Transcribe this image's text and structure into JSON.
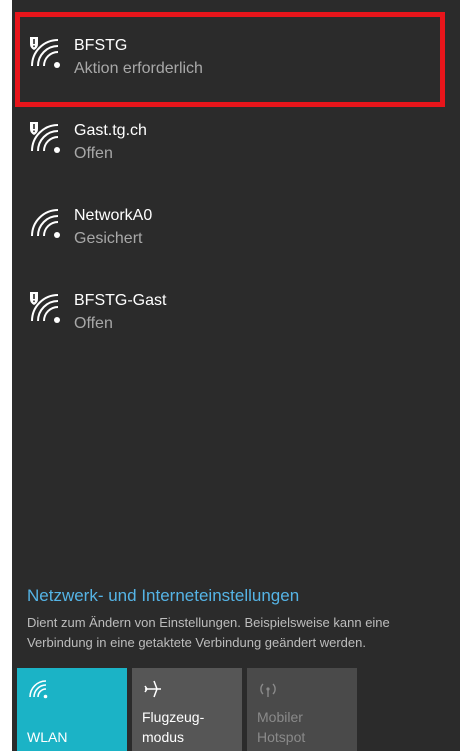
{
  "networks": [
    {
      "ssid": "BFSTG",
      "status": "Aktion erforderlich",
      "icon": "wifi-shield-warning-icon"
    },
    {
      "ssid": "Gast.tg.ch",
      "status": "Offen",
      "icon": "wifi-shield-warning-icon"
    },
    {
      "ssid": "NetworkA0",
      "status": "Gesichert",
      "icon": "wifi-icon"
    },
    {
      "ssid": "BFSTG-Gast",
      "status": "Offen",
      "icon": "wifi-shield-warning-icon"
    }
  ],
  "settings": {
    "link": "Netzwerk- und Interneteinstellungen",
    "description": "Dient zum Ändern von Einstellungen. Beispielsweise kann eine Verbindung in eine getaktete Verbindung geändert werden."
  },
  "quick_actions": [
    {
      "label_line1": "WLAN",
      "label_line2": "",
      "icon": "wifi-icon",
      "active": true
    },
    {
      "label_line1": "Flugzeug-",
      "label_line2": "modus",
      "icon": "airplane-icon",
      "active": false
    },
    {
      "label_line1": "Mobiler",
      "label_line2": "Hotspot",
      "icon": "hotspot-icon",
      "active": false,
      "disabled": true
    }
  ],
  "colors": {
    "panel_bg": "#2b2b2b",
    "accent": "#1bb3c6",
    "link": "#55b4e6",
    "highlight_box": "#e8151b"
  }
}
